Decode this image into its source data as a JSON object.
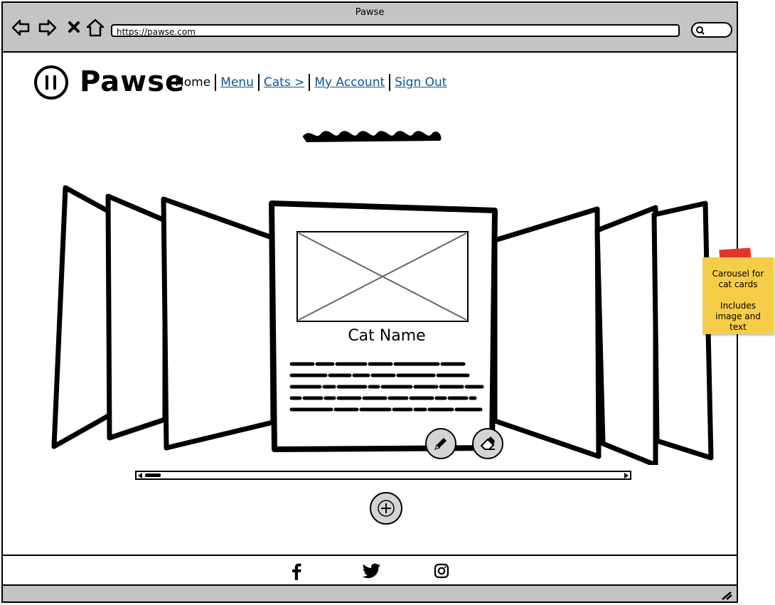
{
  "window": {
    "title": "Pawse"
  },
  "browser": {
    "url": "https://pawse.com",
    "back_icon": "arrow-left-icon",
    "forward_icon": "arrow-right-icon",
    "close_icon": "close-icon",
    "home_icon": "home-icon",
    "search_icon": "search-icon"
  },
  "header": {
    "logo_icon": "pause-icon",
    "brand": "Pawse",
    "nav": [
      {
        "label": "Home"
      },
      {
        "label": "Menu"
      },
      {
        "label": "Cats >"
      },
      {
        "label": "My Account"
      },
      {
        "label": "Sign Out"
      }
    ]
  },
  "carousel": {
    "card": {
      "title": "Cat Name",
      "image_placeholder_icon": "image-placeholder-icon"
    },
    "edit_icon": "pencil-icon",
    "delete_icon": "eraser-icon",
    "add_icon": "plus-icon"
  },
  "note": {
    "lines": [
      "Carousel for",
      "cat cards",
      "",
      "Includes",
      "image and",
      "text"
    ]
  },
  "footer": {
    "icons": [
      "facebook-icon",
      "twitter-icon",
      "instagram-icon"
    ]
  },
  "colors": {
    "chrome": "#c4c4c4",
    "link": "#0b5394",
    "note": "#f5cd48",
    "tape": "#e0352b",
    "button": "#d4d4d4"
  }
}
